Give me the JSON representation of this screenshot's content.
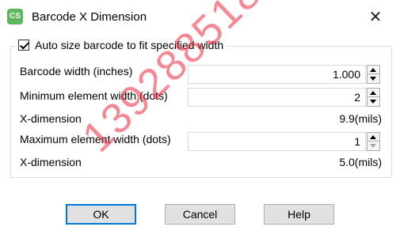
{
  "window": {
    "app_icon_text": "CS",
    "title": "Barcode X Dimension",
    "close_glyph": "✕"
  },
  "group": {
    "checkbox_label": "Auto size barcode to fit specified width",
    "checkbox_checked": true
  },
  "rows": {
    "barcode_width_label": "Barcode width (inches)",
    "barcode_width_value": "1.000",
    "min_element_label": "Minimum element width (dots)",
    "min_element_value": "2",
    "x_dim_label_1": "X-dimension",
    "x_dim_value_1": "9.9(mils)",
    "max_element_label": "Maximum element width (dots)",
    "max_element_value": "1",
    "x_dim_label_2": "X-dimension",
    "x_dim_value_2": "5.0(mils)"
  },
  "buttons": {
    "ok": "OK",
    "cancel": "Cancel",
    "help": "Help"
  },
  "watermark": "13928851814",
  "colors": {
    "accent": "#0078d7",
    "watermark": "#eb283c",
    "app_icon": "#5cb85c"
  }
}
